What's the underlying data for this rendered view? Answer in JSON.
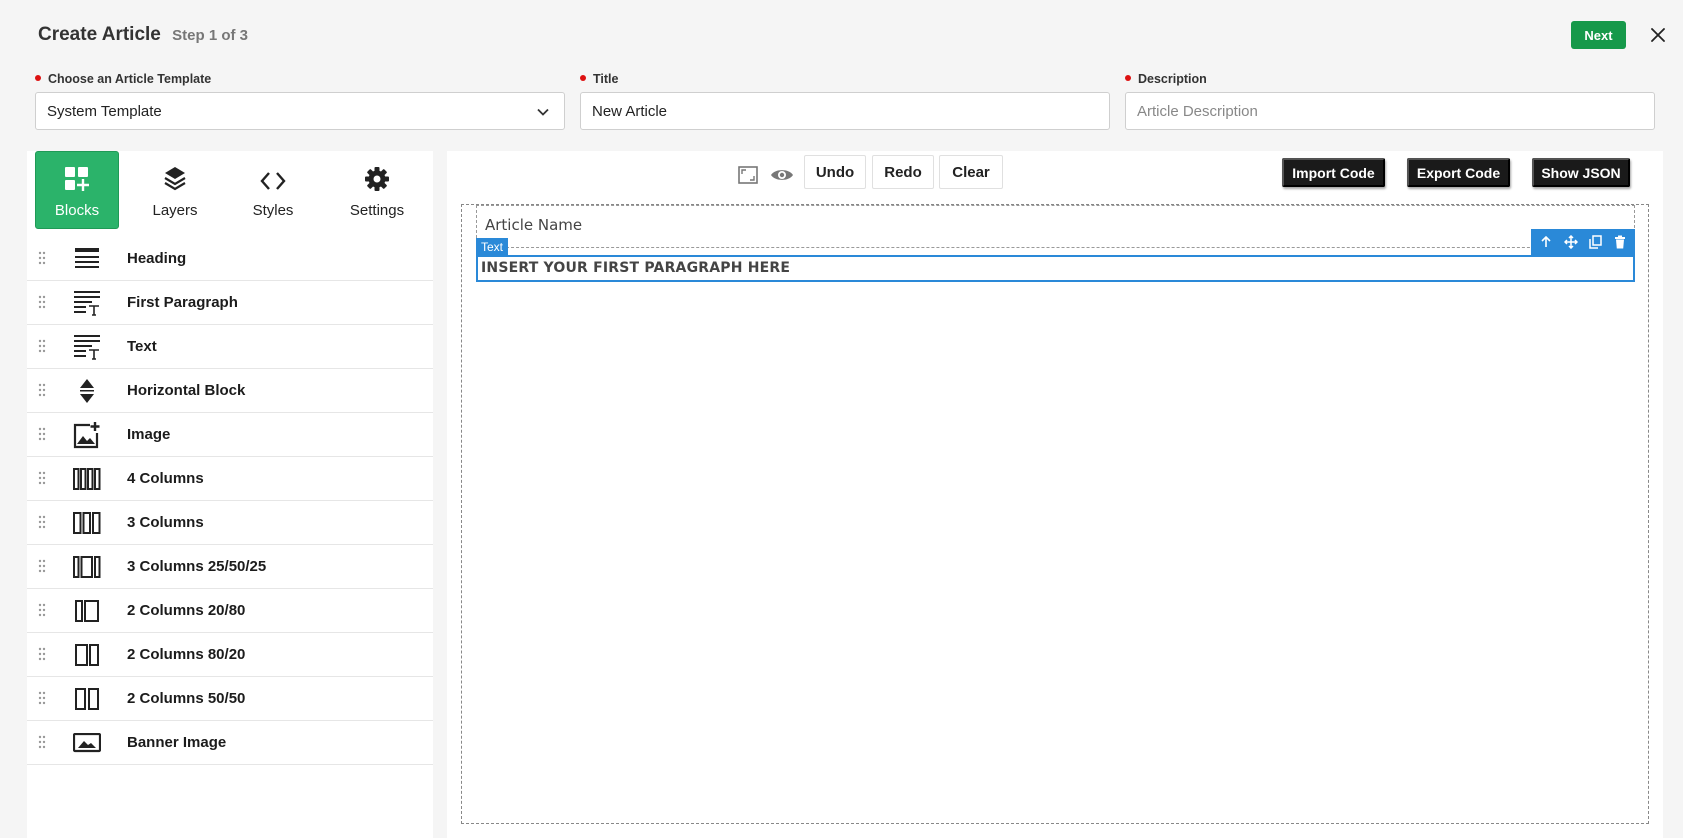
{
  "header": {
    "title": "Create Article",
    "step": "Step 1 of 3",
    "next_label": "Next"
  },
  "form": {
    "template": {
      "label": "Choose an Article Template",
      "value": "System Template"
    },
    "title": {
      "label": "Title",
      "value": "New Article"
    },
    "description": {
      "label": "Description",
      "placeholder": "Article Description"
    }
  },
  "panel": {
    "tabs": [
      {
        "label": "Blocks",
        "icon": "blocks-icon",
        "active": true
      },
      {
        "label": "Layers",
        "icon": "layers-icon"
      },
      {
        "label": "Styles",
        "icon": "code-icon"
      },
      {
        "label": "Settings",
        "icon": "gear-icon"
      }
    ],
    "blocks": [
      {
        "label": "Heading",
        "icon": "heading-icon"
      },
      {
        "label": "First Paragraph",
        "icon": "paragraph-icon"
      },
      {
        "label": "Text",
        "icon": "text-icon"
      },
      {
        "label": "Horizontal Block",
        "icon": "horizontal-block-icon"
      },
      {
        "label": "Image",
        "icon": "image-icon"
      },
      {
        "label": "4 Columns",
        "icon": "four-columns-icon"
      },
      {
        "label": "3 Columns",
        "icon": "three-columns-icon"
      },
      {
        "label": "3 Columns 25/50/25",
        "icon": "three-columns-25-50-25-icon"
      },
      {
        "label": "2 Columns 20/80",
        "icon": "two-columns-20-80-icon"
      },
      {
        "label": "2 Columns 80/20",
        "icon": "two-columns-80-20-icon"
      },
      {
        "label": "2 Columns 50/50",
        "icon": "two-columns-50-50-icon"
      },
      {
        "label": "Banner Image",
        "icon": "banner-image-icon"
      }
    ]
  },
  "toolbar": {
    "undo": "Undo",
    "redo": "Redo",
    "clear": "Clear",
    "import_code": "Import Code",
    "export_code": "Export Code",
    "show_json": "Show JSON"
  },
  "canvas": {
    "article_name": "Article Name",
    "selected_badge": "Text",
    "paragraph": "INSERT YOUR FIRST PARAGRAPH HERE"
  },
  "colors": {
    "accent_green": "#16994a",
    "tab_active_green": "#2bb36a",
    "selection_blue": "#2a89d8",
    "required_red": "#dd1111"
  }
}
